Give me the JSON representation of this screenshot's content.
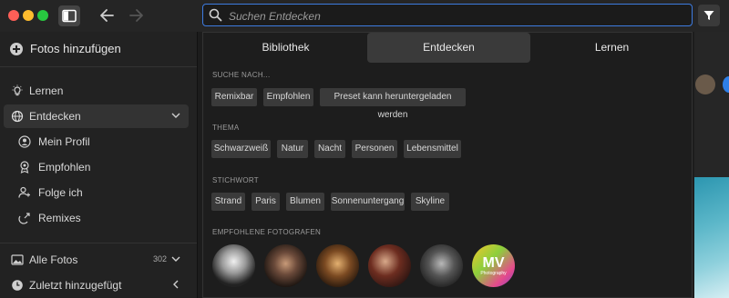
{
  "titlebar": {
    "search_placeholder": "Suchen Entdecken"
  },
  "sidebar": {
    "add_photos": "Fotos hinzufügen",
    "items": [
      {
        "label": "Lernen"
      },
      {
        "label": "Entdecken"
      },
      {
        "label": "Mein Profil"
      },
      {
        "label": "Empfohlen"
      },
      {
        "label": "Folge ich"
      },
      {
        "label": "Remixes"
      }
    ],
    "all_photos": {
      "label": "Alle Fotos",
      "count": "302"
    },
    "recent": {
      "label": "Zuletzt hinzugefügt"
    }
  },
  "dropdown": {
    "tabs": [
      "Bibliothek",
      "Entdecken",
      "Lernen"
    ],
    "active_tab": "Entdecken",
    "sections": {
      "search_for": {
        "title": "SUCHE NACH...",
        "chips": [
          "Remixbar",
          "Empfohlen",
          "Preset kann heruntergeladen werden"
        ]
      },
      "theme": {
        "title": "THEMA",
        "chips": [
          "Schwarzweiß",
          "Natur",
          "Nacht",
          "Personen",
          "Lebensmittel"
        ]
      },
      "keyword": {
        "title": "STICHWORT",
        "chips": [
          "Strand",
          "Paris",
          "Blumen",
          "Sonnenuntergang",
          "Skyline"
        ]
      },
      "photographers": {
        "title": "EMPFOHLENE FOTOGRAFEN",
        "mv_logo": "MV",
        "mv_sub": "Photography"
      }
    }
  },
  "colors": {
    "accent": "#3d7be0",
    "background": "#1c1c1c",
    "chip": "#3a3a3a"
  }
}
